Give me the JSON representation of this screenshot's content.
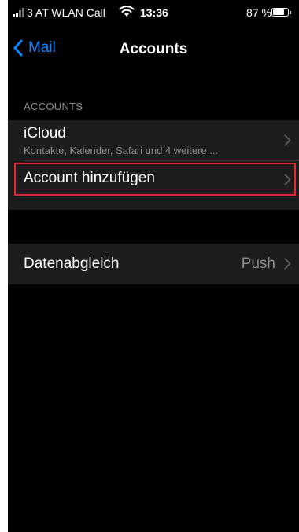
{
  "status_bar": {
    "carrier": "3 AT WLAN Call",
    "time": "13:36",
    "battery_percent": "87 %",
    "battery_level": 0.87
  },
  "nav": {
    "back_label": "Mail",
    "title": "Accounts"
  },
  "accounts_section": {
    "header": "ACCOUNTS",
    "items": [
      {
        "label": "iCloud",
        "subtitle": "Kontakte, Kalender, Safari und 4 weitere ..."
      },
      {
        "label": "Account hinzufügen"
      }
    ]
  },
  "fetch_section": {
    "label": "Datenabgleich",
    "value": "Push"
  },
  "colors": {
    "accent": "#0a84ff",
    "background": "#000000",
    "cell": "#1c1c1e",
    "secondary_text": "#8e8e93",
    "highlight_border": "#e3262f"
  }
}
